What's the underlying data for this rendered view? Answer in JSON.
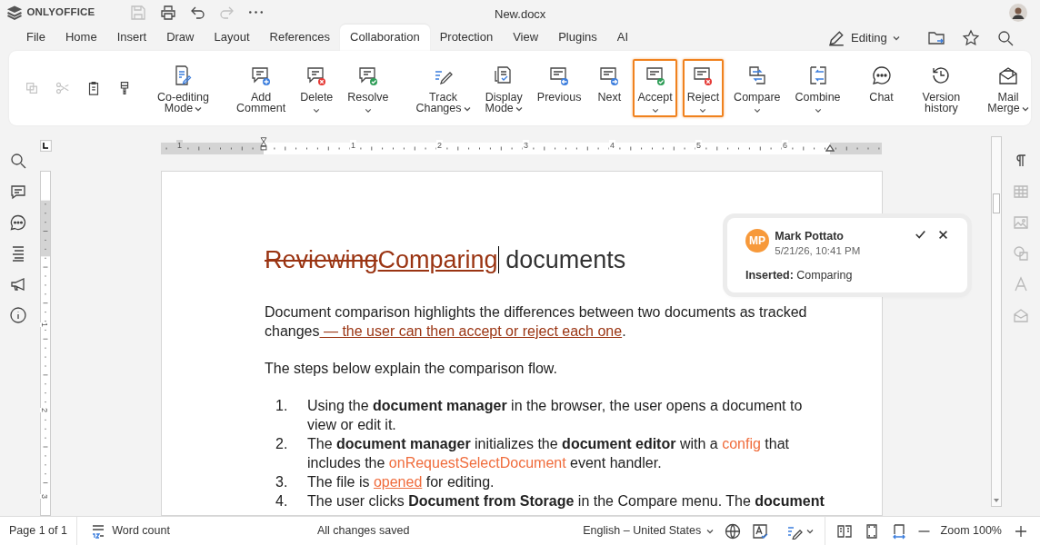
{
  "app": {
    "logo": "ONLYOFFICE",
    "title": "New.docx"
  },
  "quick_access": [
    {
      "disabled": true
    },
    {
      "disabled": false
    },
    {
      "disabled": false
    },
    {
      "disabled": true
    },
    {
      "disabled": false
    }
  ],
  "tabs": [
    {
      "label": "File",
      "selected": false
    },
    {
      "label": "Home",
      "selected": false
    },
    {
      "label": "Insert",
      "selected": false
    },
    {
      "label": "Draw",
      "selected": false
    },
    {
      "label": "Layout",
      "selected": false
    },
    {
      "label": "References",
      "selected": false
    },
    {
      "label": "Collaboration",
      "selected": true
    },
    {
      "label": "Protection",
      "selected": false
    },
    {
      "label": "View",
      "selected": false
    },
    {
      "label": "Plugins",
      "selected": false
    },
    {
      "label": "AI",
      "selected": false
    }
  ],
  "mode_button": {
    "label": "Editing"
  },
  "ribbon": {
    "groups": [
      {
        "kind": "small",
        "buttons": [
          {
            "disabled": true
          },
          {
            "disabled": true
          },
          {
            "disabled": false
          },
          {
            "disabled": false
          }
        ]
      },
      {
        "kind": "large",
        "buttons": [
          {
            "label": "Co-editing\nMode",
            "dropdown": true,
            "highlighted": false
          }
        ]
      },
      {
        "kind": "large",
        "buttons": [
          {
            "label": "Add\nComment",
            "dropdown": false,
            "highlighted": false
          },
          {
            "label": "Delete",
            "dropdown": true,
            "highlighted": false
          },
          {
            "label": "Resolve",
            "dropdown": true,
            "highlighted": false
          }
        ]
      },
      {
        "kind": "large",
        "buttons": [
          {
            "label": "Track\nChanges",
            "dropdown": true,
            "highlighted": false
          },
          {
            "label": "Display\nMode",
            "dropdown": true,
            "highlighted": false
          },
          {
            "label": "Previous",
            "dropdown": false,
            "highlighted": false
          },
          {
            "label": "Next",
            "dropdown": false,
            "highlighted": false
          },
          {
            "label": "Accept",
            "dropdown": true,
            "highlighted": true
          },
          {
            "label": "Reject",
            "dropdown": true,
            "highlighted": true
          },
          {
            "label": "Compare",
            "dropdown": true,
            "highlighted": false
          },
          {
            "label": "Combine",
            "dropdown": true,
            "highlighted": false
          }
        ]
      },
      {
        "kind": "large",
        "buttons": [
          {
            "label": "Chat",
            "dropdown": false,
            "highlighted": false
          }
        ]
      },
      {
        "kind": "large",
        "buttons": [
          {
            "label": "Version\nhistory",
            "dropdown": false,
            "highlighted": false
          }
        ]
      },
      {
        "kind": "large",
        "buttons": [
          {
            "label": "Mail\nMerge",
            "dropdown": true,
            "highlighted": false
          }
        ]
      }
    ]
  },
  "ruler": {
    "h_labels": [
      "1",
      "1",
      "2",
      "3",
      "4",
      "5",
      "6"
    ],
    "v_labels": [
      "1",
      "2",
      "3"
    ]
  },
  "right_panel": [
    {
      "disabled": false
    },
    {
      "disabled": true
    },
    {
      "disabled": true
    },
    {
      "disabled": true
    },
    {
      "disabled": true
    },
    {
      "disabled": true
    }
  ],
  "document": {
    "title": [
      {
        "kind": "deleted",
        "text": "Reviewing"
      },
      {
        "kind": "inserted",
        "text": "Comparing",
        "caret": true
      },
      {
        "kind": "text",
        "text": " documents"
      }
    ],
    "paragraphs": [
      [
        {
          "kind": "text",
          "text": "Document comparison highlights the differences between two documents as tracked changes"
        },
        {
          "kind": "inserted",
          "text": " — the user can then accept or reject each one"
        },
        {
          "kind": "text",
          "text": "."
        }
      ],
      [
        {
          "kind": "text",
          "text": "The steps below explain the comparison flow."
        }
      ]
    ],
    "steps": [
      {
        "number": "1.",
        "runs": [
          {
            "kind": "text",
            "text": "Using the "
          },
          {
            "kind": "bold",
            "text": "document manager"
          },
          {
            "kind": "text",
            "text": " in the browser, the user opens a document to view or edit it."
          }
        ]
      },
      {
        "number": "2.",
        "runs": [
          {
            "kind": "text",
            "text": "The "
          },
          {
            "kind": "bold",
            "text": "document manager"
          },
          {
            "kind": "text",
            "text": " initializes the "
          },
          {
            "kind": "bold",
            "text": "document editor"
          },
          {
            "kind": "text",
            "text": " with a "
          },
          {
            "kind": "accent",
            "text": "config"
          },
          {
            "kind": "text",
            "text": " that includes the "
          },
          {
            "kind": "accent",
            "text": "onRequestSelectDocument"
          },
          {
            "kind": "text",
            "text": " event handler."
          }
        ]
      },
      {
        "number": "3.",
        "runs": [
          {
            "kind": "text",
            "text": "The file is "
          },
          {
            "kind": "link",
            "text": "opened"
          },
          {
            "kind": "text",
            "text": " for editing."
          }
        ]
      },
      {
        "number": "4.",
        "runs": [
          {
            "kind": "text",
            "text": "The user clicks "
          },
          {
            "kind": "bold",
            "text": "Document from Storage"
          },
          {
            "kind": "text",
            "text": " in the Compare menu. The "
          },
          {
            "kind": "bold",
            "text": "document"
          }
        ]
      }
    ]
  },
  "comment": {
    "initials": "MP",
    "author": "Mark Pottato",
    "date": "5/21/26, 10:41 PM",
    "body": "**Inserted:** Comparing"
  },
  "status_bar": {
    "page": "Page 1 of 1",
    "word_count": "Word count",
    "save_state": "All changes saved",
    "language": "English – United States",
    "zoom": "Zoom 100%"
  }
}
